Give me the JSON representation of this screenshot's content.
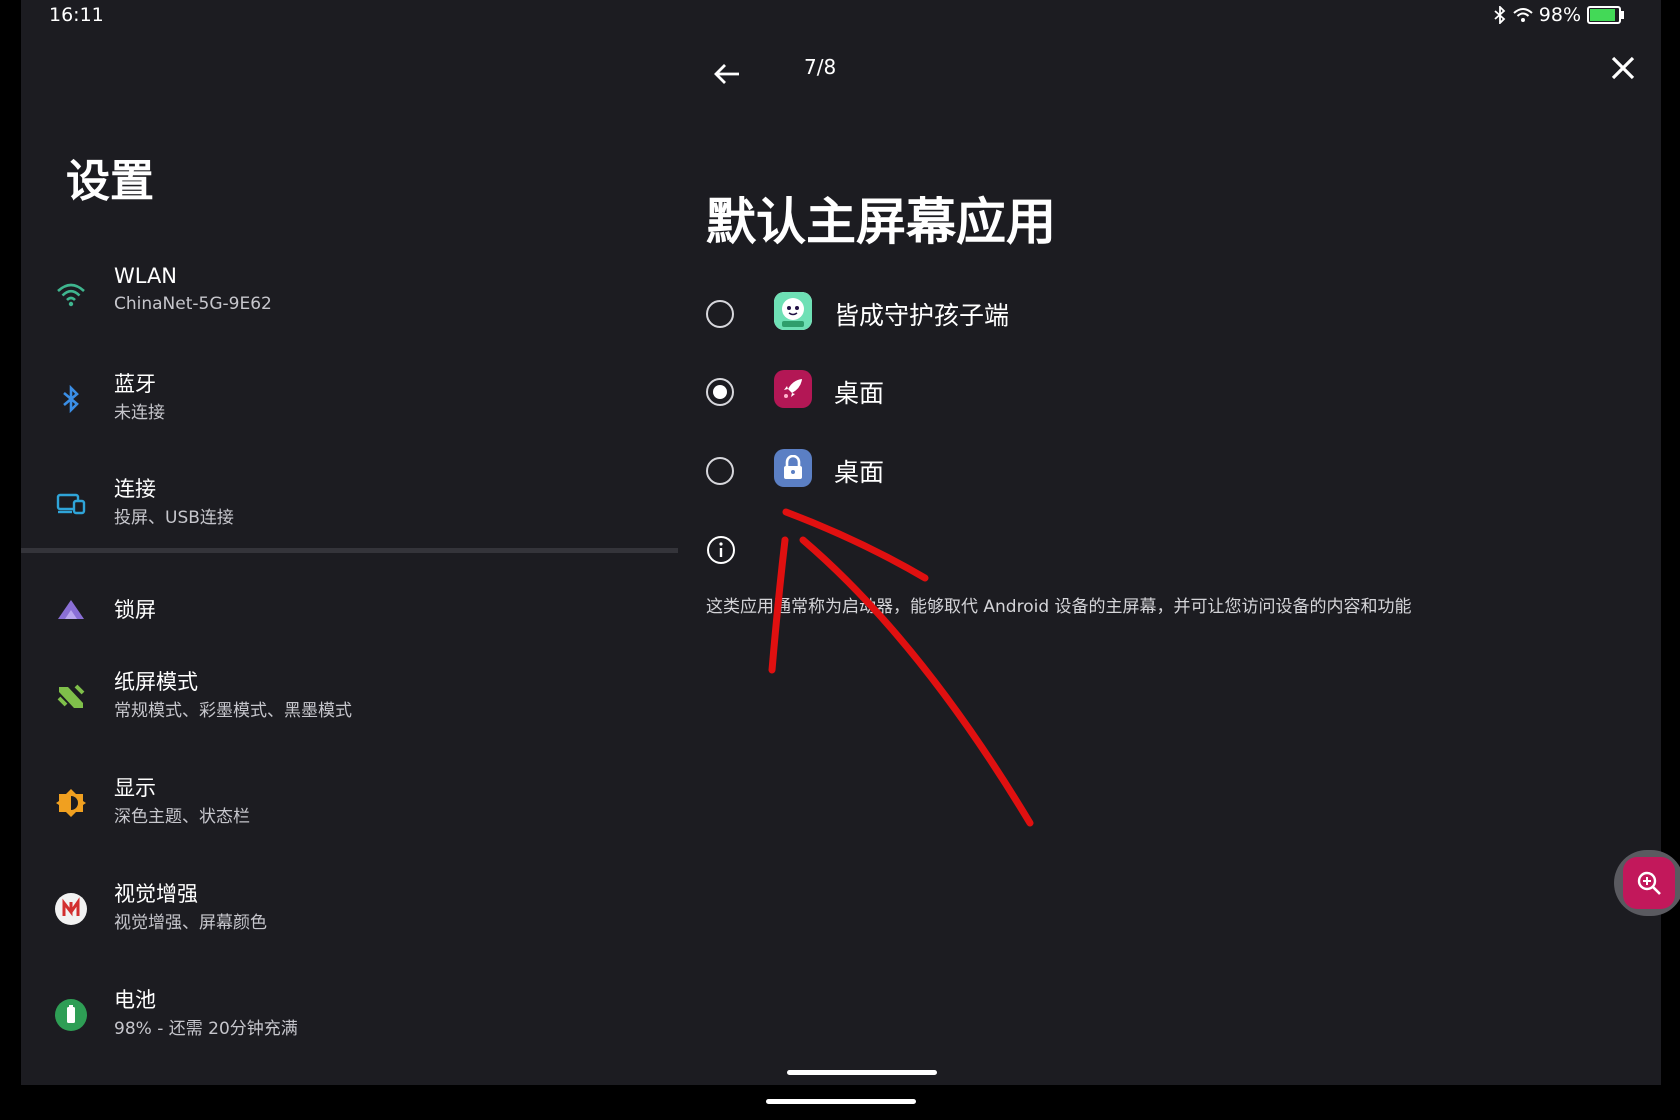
{
  "status_bar": {
    "time": "16:11",
    "battery_text": "98%",
    "battery_level": 0.98
  },
  "sidebar": {
    "title": "设置",
    "items": [
      {
        "title": "WLAN",
        "subtitle": "ChinaNet-5G-9E62",
        "icon": "wifi-icon"
      },
      {
        "title": "蓝牙",
        "subtitle": "未连接",
        "icon": "bluetooth-icon"
      },
      {
        "title": "连接",
        "subtitle": "投屏、USB连接",
        "icon": "devices-icon"
      },
      {
        "title": "锁屏",
        "subtitle": "",
        "icon": "lock-screen-icon"
      },
      {
        "title": "纸屏模式",
        "subtitle": "常规模式、彩墨模式、黑墨模式",
        "icon": "paper-mode-icon"
      },
      {
        "title": "显示",
        "subtitle": "深色主题、状态栏",
        "icon": "brightness-icon"
      },
      {
        "title": "视觉增强",
        "subtitle": "视觉增强、屏幕颜色",
        "icon": "vision-icon"
      },
      {
        "title": "电池",
        "subtitle": "98% - 还需 20分钟充满",
        "icon": "battery-icon"
      }
    ]
  },
  "panel": {
    "step": "7/8",
    "heading": "默认主屏幕应用",
    "options": [
      {
        "label": "皆成守护孩子端",
        "selected": false,
        "icon": "kids-guard-app-icon",
        "icon_color": "#ffffff"
      },
      {
        "label": "桌面",
        "selected": true,
        "icon": "rocket-launcher-icon",
        "icon_color": "#b31755"
      },
      {
        "label": "桌面",
        "selected": false,
        "icon": "lock-launcher-icon",
        "icon_color": "#5b7fc4"
      }
    ],
    "info_text": "这类应用通常称为启动器，能够取代 Android 设备的主屏幕，并可让您访问设备的内容和功能"
  },
  "colors": {
    "background": "#1c1c21",
    "annotation": "#e01010",
    "accent": "#c2185b"
  }
}
